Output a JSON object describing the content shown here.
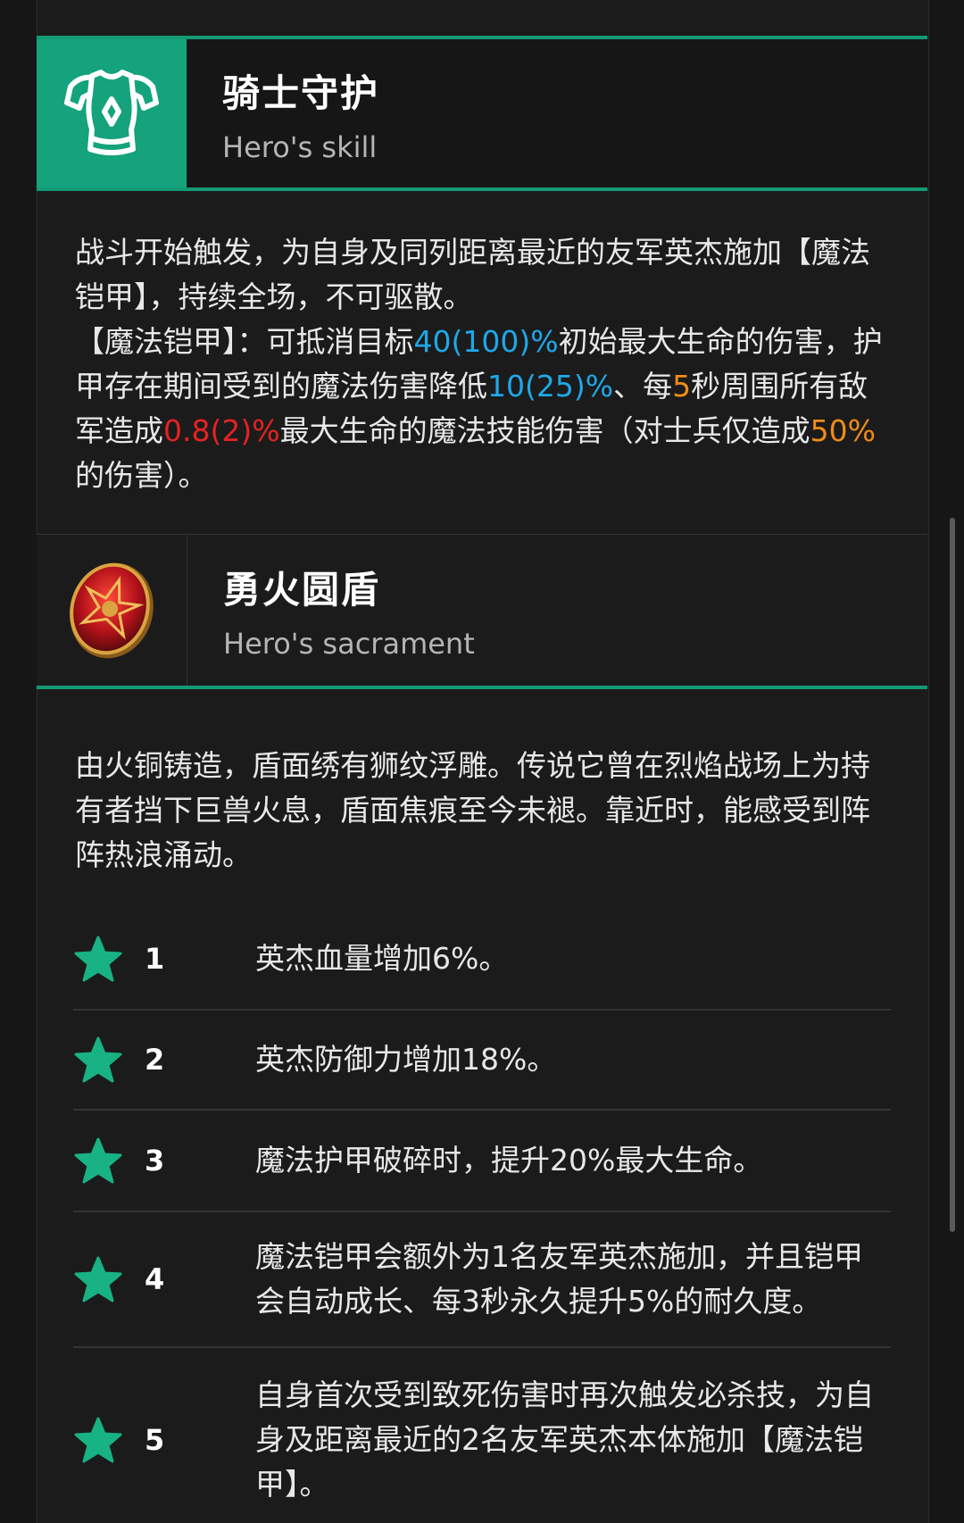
{
  "skill": {
    "icon": "armor-icon",
    "title": "骑士守护",
    "subtitle": "Hero's skill",
    "desc_line1": "战斗开始触发，为自身及同列距离最近的友军英杰施加【魔法铠甲】，持续全场，不可驱散。",
    "desc_p2_a": "【魔法铠甲】：可抵消目标",
    "desc_p2_v1": "40(100)%",
    "desc_p2_b": "初始最大生命的伤害，护甲存在期间受到的魔法伤害降低",
    "desc_p2_v2": "10(25)%",
    "desc_p2_c": "、每",
    "desc_p2_v3": "5",
    "desc_p2_d": "秒周围所有敌军造成",
    "desc_p2_v4": "0.8(2)%",
    "desc_p2_e": "最大生命的魔法技能伤害（对士兵仅造成",
    "desc_p2_v5": "50%",
    "desc_p2_f": "的伤害）。",
    "colors": {
      "blue": "#1fa8e8",
      "orange": "#f08c17",
      "red": "#e52222",
      "accent": "#14a37c"
    }
  },
  "sacrament": {
    "icon": "shield-icon",
    "title": "勇火圆盾",
    "subtitle": "Hero's sacrament",
    "desc": "由火铜铸造，盾面绣有狮纹浮雕。传说它曾在烈焰战场上为持有者挡下巨兽火息，盾面焦痕至今未褪。靠近时，能感受到阵阵热浪涌动。"
  },
  "stars": [
    {
      "num": "1",
      "text": "英杰血量增加6%。"
    },
    {
      "num": "2",
      "text": "英杰防御力增加18%。"
    },
    {
      "num": "3",
      "text": "魔法护甲破碎时，提升20%最大生命。"
    },
    {
      "num": "4",
      "text": "魔法铠甲会额外为1名友军英杰施加，并且铠甲会自动成长、每3秒永久提升5%的耐久度。"
    },
    {
      "num": "5",
      "text": "自身首次受到致死伤害时再次触发必杀技，为自身及距离最近的2名友军英杰本体施加【魔法铠甲】。"
    }
  ]
}
